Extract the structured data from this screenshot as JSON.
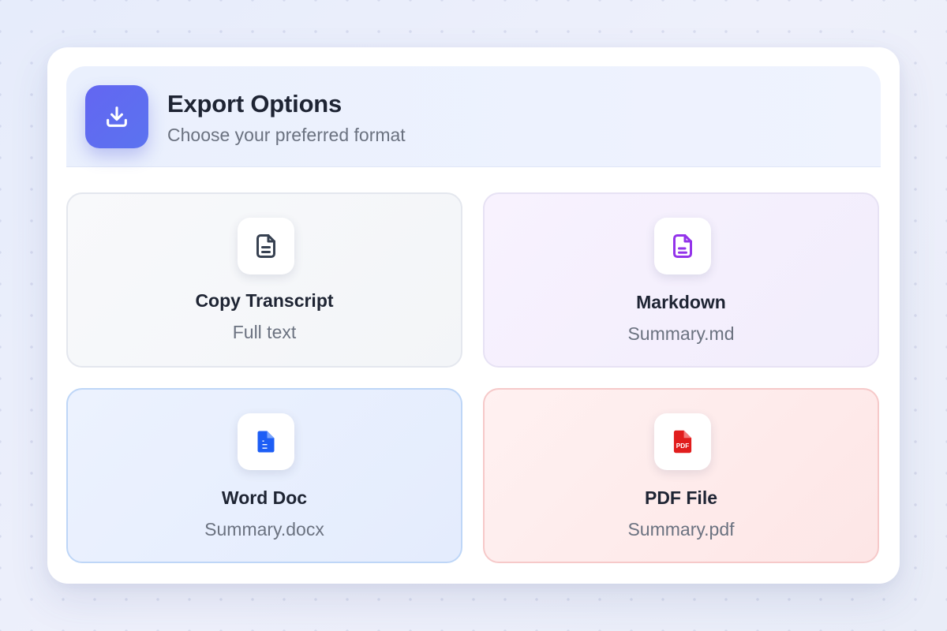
{
  "header": {
    "icon": "download-icon",
    "title": "Export Options",
    "subtitle": "Choose your preferred format"
  },
  "options": [
    {
      "title": "Copy Transcript",
      "subtitle": "Full text",
      "icon": "document-icon",
      "color": "#374151"
    },
    {
      "title": "Markdown",
      "subtitle": "Summary.md",
      "icon": "markdown-file-icon",
      "color": "#9333ea"
    },
    {
      "title": "Word Doc",
      "subtitle": "Summary.docx",
      "icon": "word-document-icon",
      "color": "#1d5ef5"
    },
    {
      "title": "PDF File",
      "subtitle": "Summary.pdf",
      "icon": "pdf-file-icon",
      "icon_text": "PDF",
      "color": "#e11d1d"
    }
  ],
  "colors": {
    "accent": "#6366f1",
    "text_primary": "#1e2433",
    "text_secondary": "#6b7280"
  }
}
